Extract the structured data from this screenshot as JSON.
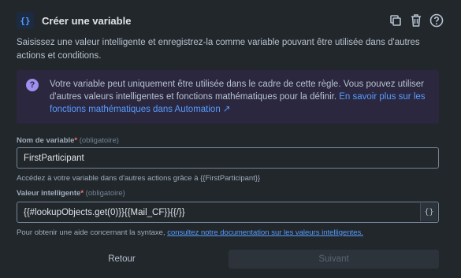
{
  "header": {
    "icon_text": "{}",
    "title": "Créer une variable",
    "actions": [
      "copy-icon",
      "trash-icon",
      "help-icon"
    ]
  },
  "description": "Saisissez une valeur intelligente et enregistrez-la comme variable pouvant être utilisée dans d'autres actions et conditions.",
  "info": {
    "icon_text": "?",
    "text": "Votre variable peut uniquement être utilisée dans le cadre de cette règle. Vous pouvez utiliser d'autres valeurs intelligentes et fonctions mathématiques pour la définir.",
    "link_text": "En savoir plus sur les fonctions mathématiques dans Automation ↗"
  },
  "variable_name": {
    "label": "Nom de variable",
    "required_mark": "*",
    "optional_text": "(obligatoire)",
    "value": "FirstParticipant",
    "helper": "Accédez à votre variable dans d'autres actions grâce à {{FirstParticipant}}"
  },
  "smart_value": {
    "label": "Valeur intelligente",
    "required_mark": "*",
    "optional_text": "(obligatoire)",
    "value": "{{#lookupObjects.get(0)}}{{Mail_CF}}{{/}}",
    "button_text": "{}",
    "helper_prefix": "Pour obtenir une aide concernant la syntaxe,",
    "helper_link": "consultez notre documentation sur les valeurs intelligentes."
  },
  "footer": {
    "back_label": "Retour",
    "next_label": "Suivant"
  }
}
